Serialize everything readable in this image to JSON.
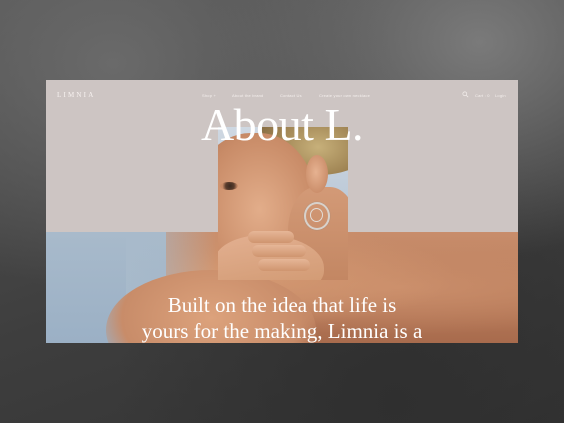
{
  "brand": {
    "logo": "LIMNIA"
  },
  "nav": {
    "items": [
      "Shop +",
      "About the brand",
      "Contact Us",
      "Create your own necklace"
    ],
    "cart": "Cart : 0",
    "login": "Login"
  },
  "hero": {
    "title": "About L.",
    "body_line1": "Built on the idea that life is",
    "body_line2": "yours for the making, Limnia is a"
  },
  "icons": {
    "search": "search-icon"
  },
  "colors": {
    "page_bg": "#cdc5c3",
    "text": "#ffffff",
    "sky": "#a8bacb",
    "skin": "#c88d6b"
  }
}
